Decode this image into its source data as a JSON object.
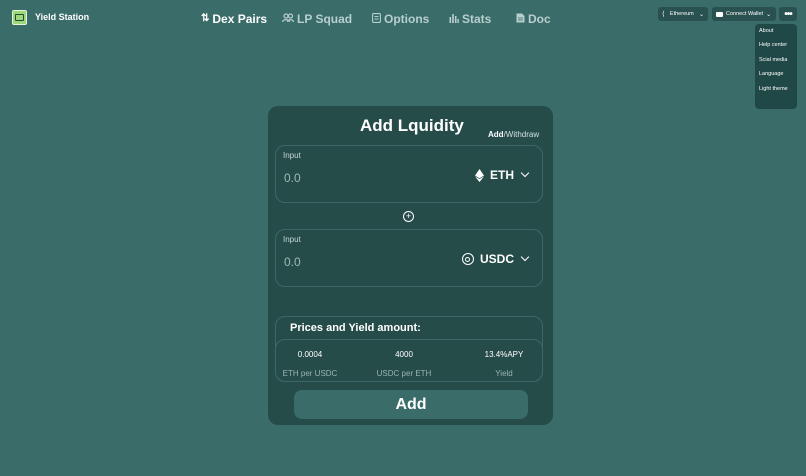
{
  "app": {
    "name": "Yield Station"
  },
  "nav": [
    {
      "label": "Dex Pairs",
      "icon": "swap-vertical-icon"
    },
    {
      "label": "LP Squad",
      "icon": "people-icon"
    },
    {
      "label": "Options",
      "icon": "document-list-icon"
    },
    {
      "label": "Stats",
      "icon": "bar-chart-icon"
    },
    {
      "label": "Doc",
      "icon": "document-icon"
    }
  ],
  "header": {
    "chain_label": "Ethereum",
    "wallet_label": "Connect Wallet",
    "more_label": "•••"
  },
  "menu": {
    "items": [
      "About",
      "Help center",
      "Scial media",
      "Language",
      "Light theme"
    ]
  },
  "card": {
    "title": "Add Lquidity",
    "mode_add": "Add",
    "mode_sep": "/",
    "mode_withdraw": "Withdraw",
    "input1": {
      "label": "Input",
      "value": "0.0",
      "token": "ETH"
    },
    "input2": {
      "label": "Input",
      "value": "0.0",
      "token": "USDC"
    },
    "plus": "+",
    "yield": {
      "title": "Prices and Yield amount:",
      "stats": [
        {
          "value": "0.0004",
          "label": "ETH per USDC"
        },
        {
          "value": "4000",
          "label": "USDC per ETH"
        },
        {
          "value": "13.4%APY",
          "label": "Yield"
        }
      ]
    },
    "button": "Add"
  },
  "colors": {
    "background": "#3a6c6a",
    "card": "#264c4a",
    "button": "#28514f"
  }
}
